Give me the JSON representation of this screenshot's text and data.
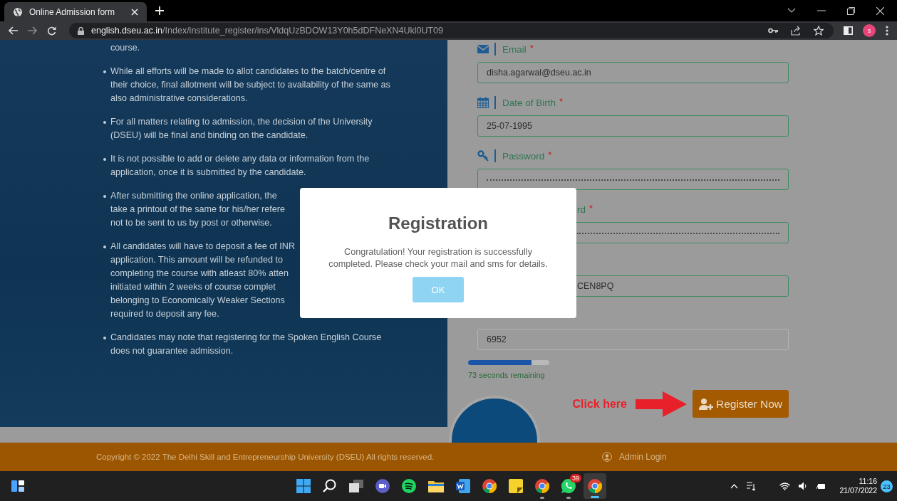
{
  "browser": {
    "tab": {
      "title": "Online Admission form",
      "selected": true
    },
    "address": {
      "host": "english.dseu.ac.in",
      "path": "/Index/institute_register/ins/VldqUzBDOW13Y0h5dDFNeXN4Ukl0UT09"
    },
    "profile_initial": "s"
  },
  "info_panel": {
    "continued_text": "course.",
    "items": [
      {
        "lines": [
          "While all efforts will be made to allot candidates to the batch/centre of",
          "their choice, final allotment will be subject to availability of the same as",
          "also administrative considerations."
        ]
      },
      {
        "lines": [
          "For all matters relating to admission, the decision of the University",
          "(DSEU) will be final and binding on the candidate."
        ]
      },
      {
        "lines": [
          "It is not possible to add or delete any data or information from the",
          "application, once it is submitted by the candidate."
        ]
      },
      {
        "lines": [
          "After submitting the online application, the",
          "take a printout of the same for his/her refere",
          "not to be sent to us by post or otherwise."
        ]
      },
      {
        "lines": [
          "All candidates will have to deposit a fee of INR",
          "application. This amount will be refunded to",
          "completing the course with atleast 80% atten",
          "initiated within 2 weeks of course complet",
          "belonging to Economically Weaker Sections",
          "required to deposit any fee."
        ]
      },
      {
        "lines": [
          "Candidates may note that registering for the Spoken English Course",
          "does not guarantee admission."
        ]
      }
    ]
  },
  "form": {
    "fields": [
      {
        "kind": "email",
        "label": "Email",
        "required_mark": "*",
        "value": "disha.agarwal@dseu.ac.in",
        "validated": true
      },
      {
        "kind": "date",
        "label": "Date of Birth",
        "required_mark": "*",
        "value": "25-07-1995",
        "validated": true
      },
      {
        "kind": "password",
        "label": "Password",
        "required_mark": "*",
        "validated": true
      },
      {
        "kind": "confirm",
        "label": "rd",
        "required_mark": "*",
        "validated": true
      },
      {
        "kind": "code",
        "value": "CEN8PQ",
        "validated": true
      },
      {
        "kind": "captcha",
        "value": "6952",
        "validated": false
      }
    ],
    "timer": {
      "level": 0.78,
      "text": "73 seconds remaining"
    },
    "hint": "Click here",
    "submit": "Register Now"
  },
  "footer": {
    "copyright": "Copyright © 2022 The Delhi Skill and Entrepreneurship University (DSEU) All rights reserved.",
    "admin_link": "Admin Login"
  },
  "modal": {
    "title": "Registration",
    "message_lines": [
      "Congratulation! Your registration is successfully",
      "completed. Please check your mail and sms for details."
    ],
    "button": "OK"
  },
  "taskbar": {
    "whatsapp_badge": "39",
    "time": "11:16",
    "date": "21/07/2022",
    "notifications": "23"
  }
}
